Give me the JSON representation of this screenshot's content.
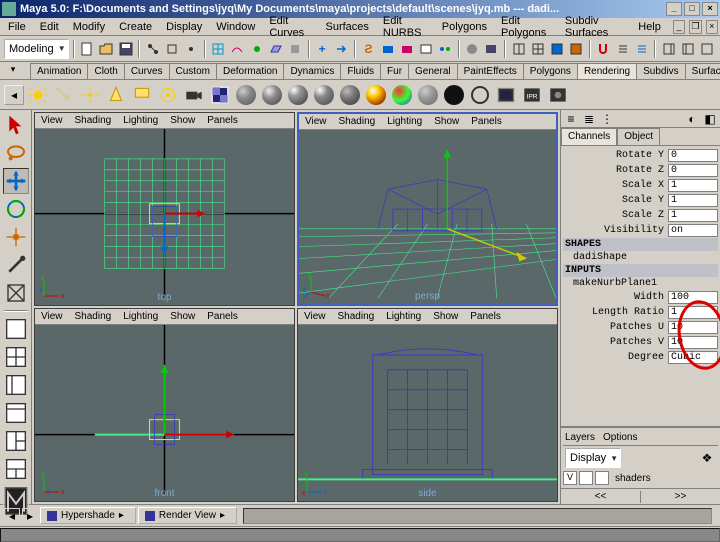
{
  "title": "Maya 5.0: F:\\Documents and Settings\\jyq\\My Documents\\maya\\projects\\default\\scenes\\jyq.mb --- dadi...",
  "menus": [
    "File",
    "Edit",
    "Modify",
    "Create",
    "Display",
    "Window",
    "Edit Curves",
    "Surfaces",
    "Edit NURBS",
    "Polygons",
    "Edit Polygons",
    "Subdiv Surfaces",
    "Help"
  ],
  "mode_dropdown": "Modeling",
  "shelf_tabs": [
    "Animation",
    "Cloth",
    "Curves",
    "Custom",
    "Deformation",
    "Dynamics",
    "Fluids",
    "Fur",
    "General",
    "PaintEffects",
    "Polygons",
    "Rendering",
    "Subdivs",
    "Surfaces"
  ],
  "shelf_active": "Rendering",
  "viewport_menu": [
    "View",
    "Shading",
    "Lighting",
    "Show",
    "Panels"
  ],
  "viewport_labels": {
    "tl": "top",
    "tr": "persp",
    "bl": "front",
    "br": "side"
  },
  "channels": {
    "tab1": "Channels",
    "tab2": "Object",
    "attrs": [
      {
        "label": "Rotate Y",
        "value": "0"
      },
      {
        "label": "Rotate Z",
        "value": "0"
      },
      {
        "label": "Scale X",
        "value": "1"
      },
      {
        "label": "Scale Y",
        "value": "1"
      },
      {
        "label": "Scale Z",
        "value": "1"
      },
      {
        "label": "Visibility",
        "value": "on"
      }
    ],
    "shapes_hdr": "SHAPES",
    "shape_name": "dadiShape",
    "inputs_hdr": "INPUTS",
    "input_name": "makeNurbPlane1",
    "input_attrs": [
      {
        "label": "Width",
        "value": "100"
      },
      {
        "label": "Length Ratio",
        "value": "1"
      },
      {
        "label": "Patches U",
        "value": "10"
      },
      {
        "label": "Patches V",
        "value": "10"
      },
      {
        "label": "Degree",
        "value": "Cubic"
      }
    ]
  },
  "layers": {
    "tab1": "Layers",
    "tab2": "Options",
    "display": "Display",
    "row1": "shaders"
  },
  "status_tabs": [
    "Hypershade",
    "Render View"
  ],
  "nav": {
    "left": "<<",
    "right": ">>"
  }
}
